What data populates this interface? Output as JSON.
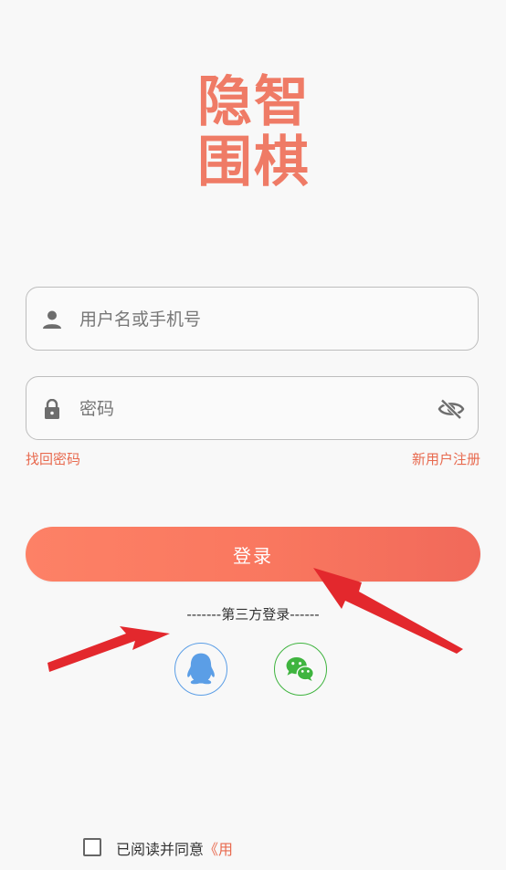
{
  "logo": {
    "chars": [
      "隐",
      "智",
      "围",
      "棋"
    ],
    "color": "#ef7b66"
  },
  "username": {
    "placeholder": "用户名或手机号",
    "value": "",
    "icon": "person-icon"
  },
  "password": {
    "placeholder": "密码",
    "value": "",
    "icon": "lock-icon",
    "toggle_icon": "eye-off-icon"
  },
  "links": {
    "forgot": "找回密码",
    "register": "新用户注册"
  },
  "login_button": "登录",
  "third_party": {
    "title": "-------第三方登录------",
    "providers": [
      {
        "name": "qq",
        "icon": "qq-penguin-icon",
        "color": "#5b9ee6"
      },
      {
        "name": "wechat",
        "icon": "wechat-icon",
        "color": "#3fb43f"
      }
    ]
  },
  "agreement": {
    "checked": false,
    "text": "已阅读并同意",
    "link": "《用"
  },
  "colors": {
    "accent": "#f9775f",
    "link": "#e86a4f",
    "annotation_arrow": "#e3282d"
  }
}
